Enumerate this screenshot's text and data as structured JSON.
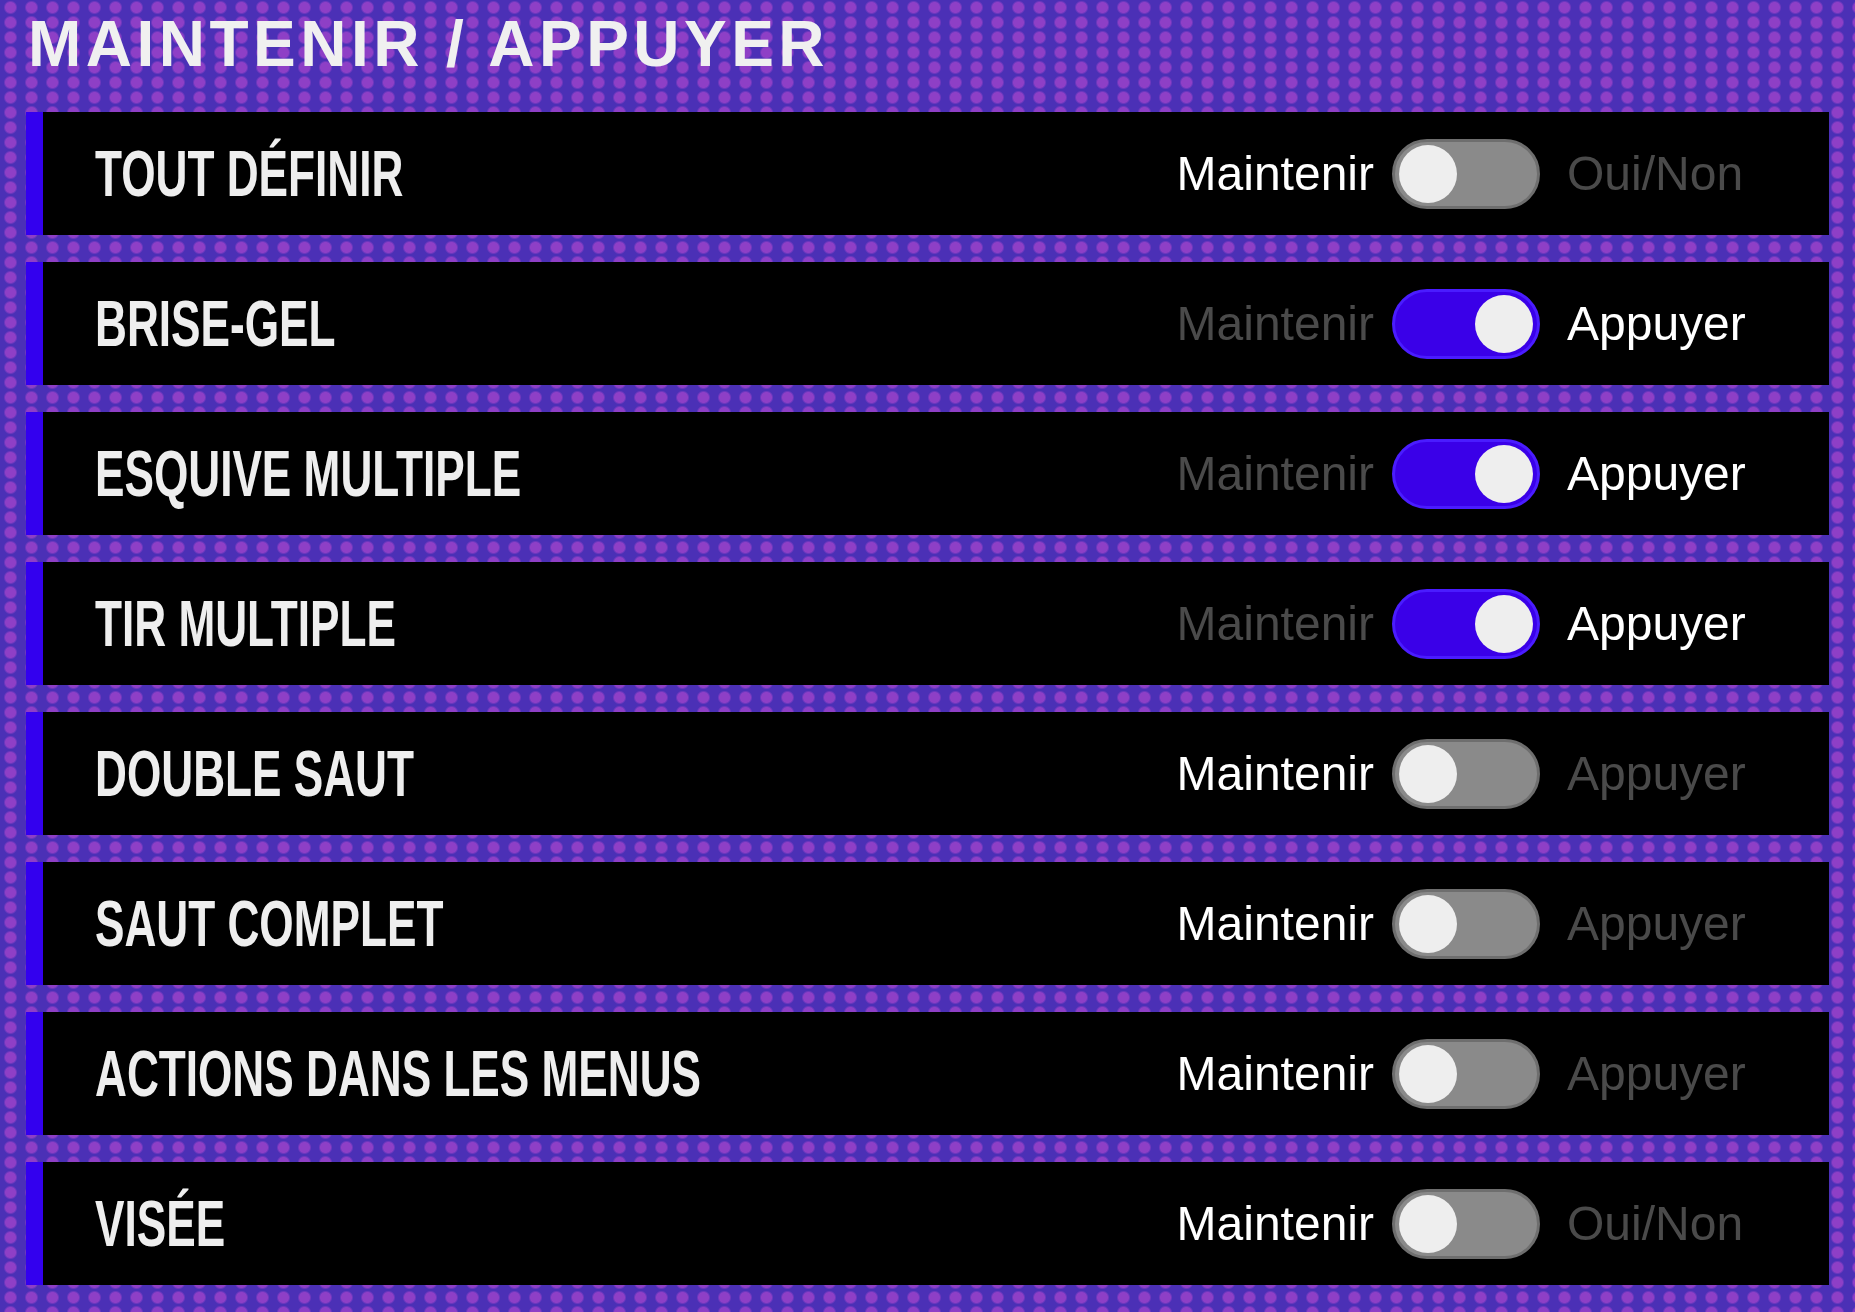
{
  "title": "MAINTENIR / APPUYER",
  "rows": [
    {
      "label": "TOUT DÉFINIR",
      "left_option": "Maintenir",
      "right_option": "Oui/Non",
      "on": false
    },
    {
      "label": "BRISE-GEL",
      "left_option": "Maintenir",
      "right_option": "Appuyer",
      "on": true
    },
    {
      "label": "ESQUIVE MULTIPLE",
      "left_option": "Maintenir",
      "right_option": "Appuyer",
      "on": true
    },
    {
      "label": "TIR MULTIPLE",
      "left_option": "Maintenir",
      "right_option": "Appuyer",
      "on": true
    },
    {
      "label": "DOUBLE SAUT",
      "left_option": "Maintenir",
      "right_option": "Appuyer",
      "on": false
    },
    {
      "label": "SAUT COMPLET",
      "left_option": "Maintenir",
      "right_option": "Appuyer",
      "on": false
    },
    {
      "label": "ACTIONS DANS LES MENUS",
      "left_option": "Maintenir",
      "right_option": "Appuyer",
      "on": false
    },
    {
      "label": "VISÉE",
      "left_option": "Maintenir",
      "right_option": "Oui/Non",
      "on": false
    }
  ]
}
